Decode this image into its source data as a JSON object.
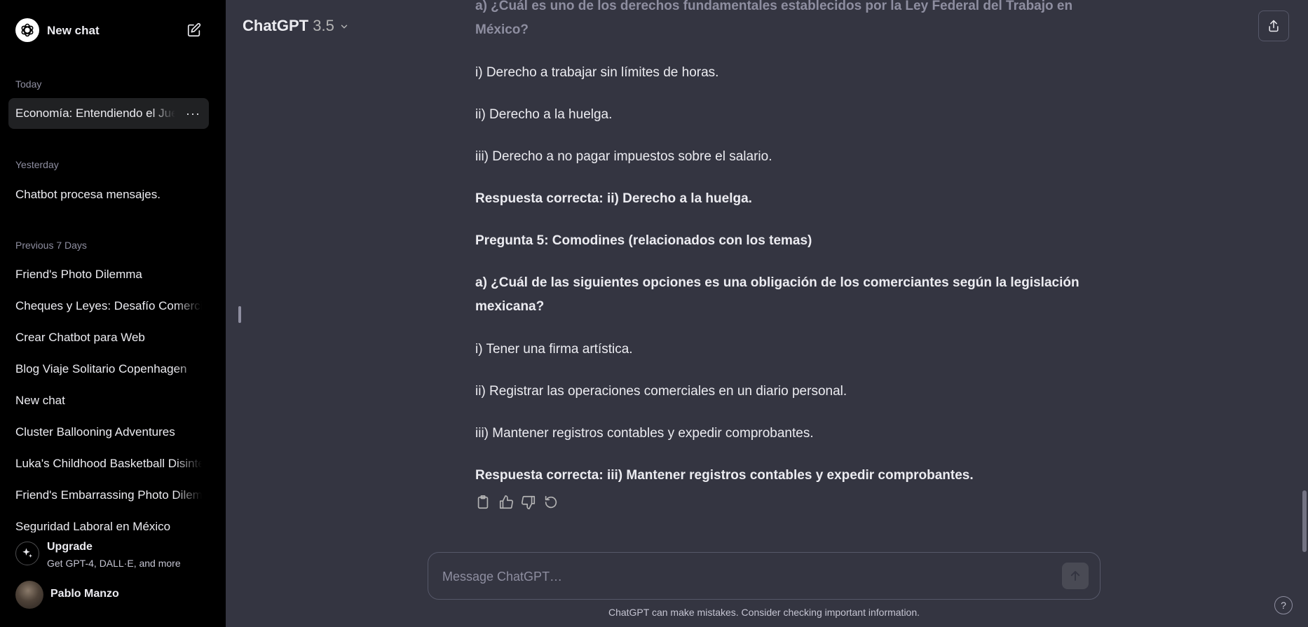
{
  "sidebar": {
    "new_chat": "New chat",
    "sections": {
      "today": "Today",
      "yesterday": "Yesterday",
      "previous7": "Previous 7 Days"
    },
    "today_items": [
      "Economía: Entendiendo el Juego"
    ],
    "yesterday_items": [
      "Chatbot procesa mensajes."
    ],
    "previous7_items": [
      "Friend's Photo Dilemma",
      "Cheques y Leyes: Desafío Comercial",
      "Crear Chatbot para Web",
      "Blog Viaje Solitario Copenhagen",
      "New chat",
      "Cluster Ballooning Adventures",
      "Luka's Childhood Basketball Disinterest",
      "Friend's Embarrassing Photo Dilemma",
      "Seguridad Laboral en México"
    ],
    "more_icon": "···",
    "upgrade": {
      "title": "Upgrade",
      "subtitle": "Get GPT-4, DALL·E, and more"
    },
    "user": {
      "name": "Pablo Manzo"
    }
  },
  "header": {
    "model": "ChatGPT",
    "version": "3.5",
    "icons": [
      "chevron-down-icon",
      "share-icon"
    ]
  },
  "conversation": {
    "paragraphs": [
      "a) ¿Cuál es uno de los derechos fundamentales establecidos por la Ley Federal del Trabajo en México?",
      "i) Derecho a trabajar sin límites de horas.",
      "ii) Derecho a la huelga.",
      "iii) Derecho a no pagar impuestos sobre el salario.",
      "Respuesta correcta: ii) Derecho a la huelga.",
      "Pregunta 5: Comodines (relacionados con los temas)",
      "a) ¿Cuál de las siguientes opciones es una obligación de los comerciantes según la legislación mexicana?",
      "i) Tener una firma artística.",
      "ii) Registrar las operaciones comerciales en un diario personal.",
      "iii) Mantener registros contables y expedir comprobantes.",
      "Respuesta correcta: iii) Mantener registros contables y expedir comprobantes."
    ],
    "action_icons": [
      "copy-icon",
      "thumbs-up-icon",
      "thumbs-down-icon",
      "regenerate-icon"
    ]
  },
  "composer": {
    "placeholder": "Message ChatGPT…",
    "disclaimer": "ChatGPT can make mistakes. Consider checking important information.",
    "help": "?"
  },
  "colors": {
    "sidebar_bg": "#000000",
    "main_bg": "#343541",
    "text": "#ececf1",
    "muted": "#8e8ea0"
  }
}
